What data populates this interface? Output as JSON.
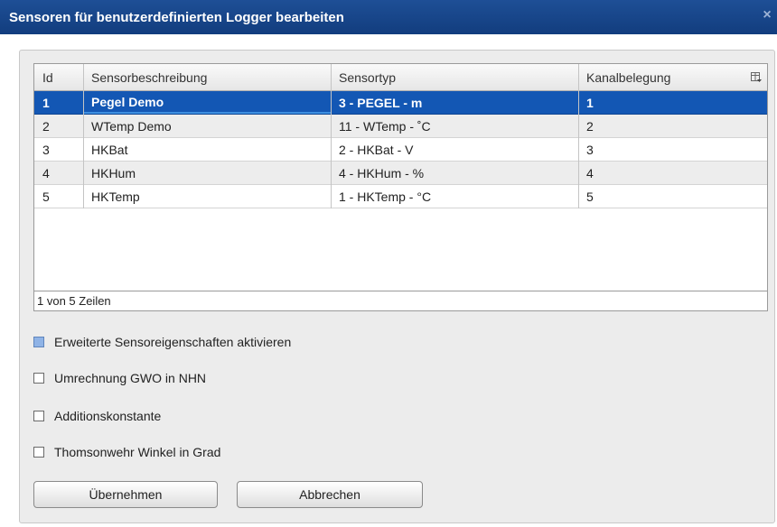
{
  "window": {
    "title": "Sensoren für benutzerdefinierten Logger bearbeiten",
    "close_glyph": "×"
  },
  "table": {
    "columns": [
      "Id",
      "Sensorbeschreibung",
      "Sensortyp",
      "Kanalbelegung"
    ],
    "rows": [
      {
        "id": "1",
        "beschreibung": "Pegel Demo",
        "typ": "3 - PEGEL - m",
        "kanal": "1"
      },
      {
        "id": "2",
        "beschreibung": "WTemp Demo",
        "typ": "11 - WTemp - ˚C",
        "kanal": "2"
      },
      {
        "id": "3",
        "beschreibung": "HKBat",
        "typ": "2 - HKBat - V",
        "kanal": "3"
      },
      {
        "id": "4",
        "beschreibung": "HKHum",
        "typ": "4 - HKHum - %",
        "kanal": "4"
      },
      {
        "id": "5",
        "beschreibung": "HKTemp",
        "typ": "1 - HKTemp - °C",
        "kanal": "5"
      }
    ],
    "selected_row": 1,
    "footer": "1 von 5 Zeilen",
    "column_menu_icon": "column-chooser-icon"
  },
  "options": [
    {
      "label": "Erweiterte Sensoreigenschaften aktivieren",
      "checked": true
    },
    {
      "label": "Umrechnung GWO in NHN",
      "checked": false
    },
    {
      "label": "Additionskonstante",
      "checked": false
    },
    {
      "label": "Thomsonwehr Winkel in Grad",
      "checked": false
    }
  ],
  "buttons": {
    "apply": "Übernehmen",
    "cancel": "Abbrechen"
  },
  "colors": {
    "titlebar": "#1a4a8e",
    "selection": "#1357b4",
    "checked_box": "#8fb3e6"
  }
}
